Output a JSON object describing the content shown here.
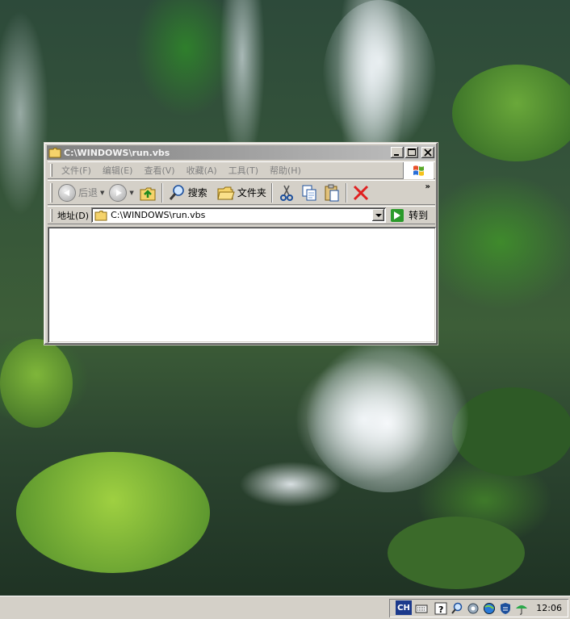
{
  "window": {
    "title": "C:\\WINDOWS\\run.vbs",
    "controls": {
      "minimize": "_",
      "maximize": "□",
      "close": "✕"
    }
  },
  "menubar": {
    "items": [
      {
        "label": "文件(F)"
      },
      {
        "label": "编辑(E)"
      },
      {
        "label": "查看(V)"
      },
      {
        "label": "收藏(A)"
      },
      {
        "label": "工具(T)"
      },
      {
        "label": "帮助(H)"
      }
    ]
  },
  "toolbar": {
    "back_label": "后退",
    "search_label": "搜索",
    "folders_label": "文件夹",
    "overflow": "»"
  },
  "addressbar": {
    "label": "地址(D)",
    "value": "C:\\WINDOWS\\run.vbs",
    "go_label": "转到"
  },
  "taskbar": {
    "ime": "CH",
    "clock": "12:06"
  },
  "icons": {
    "folder": "folder-icon",
    "back": "back-arrow-icon",
    "forward": "forward-arrow-icon",
    "up": "up-folder-icon",
    "search": "magnifier-icon",
    "cut": "scissors-icon",
    "copy": "copy-icon",
    "paste": "paste-icon",
    "delete": "red-x-icon"
  },
  "colors": {
    "window_face": "#d4d0c8",
    "inactive_title": "#808080",
    "go_green": "#2a9a2a",
    "delete_red": "#e02020"
  }
}
